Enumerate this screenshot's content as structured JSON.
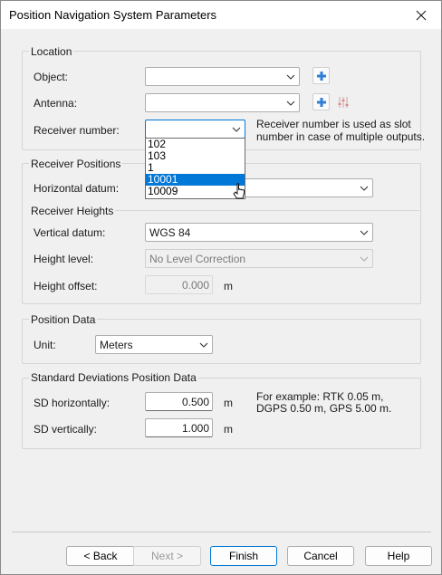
{
  "window": {
    "title": "Position Navigation System Parameters"
  },
  "location": {
    "group_title": "Location",
    "object_label": "Object:",
    "object_value": "",
    "antenna_label": "Antenna:",
    "antenna_value": "",
    "receiver_label": "Receiver number:",
    "receiver_value": "",
    "receiver_note_line1": "Receiver number is used as slot",
    "receiver_note_line2": "number in case of multiple outputs.",
    "receiver_options": [
      "102",
      "103",
      "1",
      "10001",
      "10009"
    ],
    "receiver_highlighted": "10001"
  },
  "receiver_positions": {
    "group_title": "Receiver Positions",
    "horizontal_label": "Horizontal datum:",
    "horizontal_value": ""
  },
  "receiver_heights": {
    "group_title": "Receiver Heights",
    "vertical_label": "Vertical datum:",
    "vertical_value": "WGS 84",
    "height_level_label": "Height level:",
    "height_level_value": "No Level Correction",
    "height_offset_label": "Height offset:",
    "height_offset_value": "0.000",
    "height_offset_unit": "m"
  },
  "position_data": {
    "group_title": "Position Data",
    "unit_label": "Unit:",
    "unit_value": "Meters"
  },
  "std_dev": {
    "group_title": "Standard Deviations Position Data",
    "sd_h_label": "SD horizontally:",
    "sd_h_value": "0.500",
    "sd_h_unit": "m",
    "sd_v_label": "SD vertically:",
    "sd_v_value": "1.000",
    "sd_v_unit": "m",
    "example_line1": "For example: RTK 0.05 m,",
    "example_line2": "DGPS 0.50 m, GPS 5.00 m."
  },
  "buttons": {
    "back": "< Back",
    "next": "Next >",
    "finish": "Finish",
    "cancel": "Cancel",
    "help": "Help"
  },
  "colors": {
    "accent": "#0078d7",
    "add_icon": "#2f7fd6"
  }
}
